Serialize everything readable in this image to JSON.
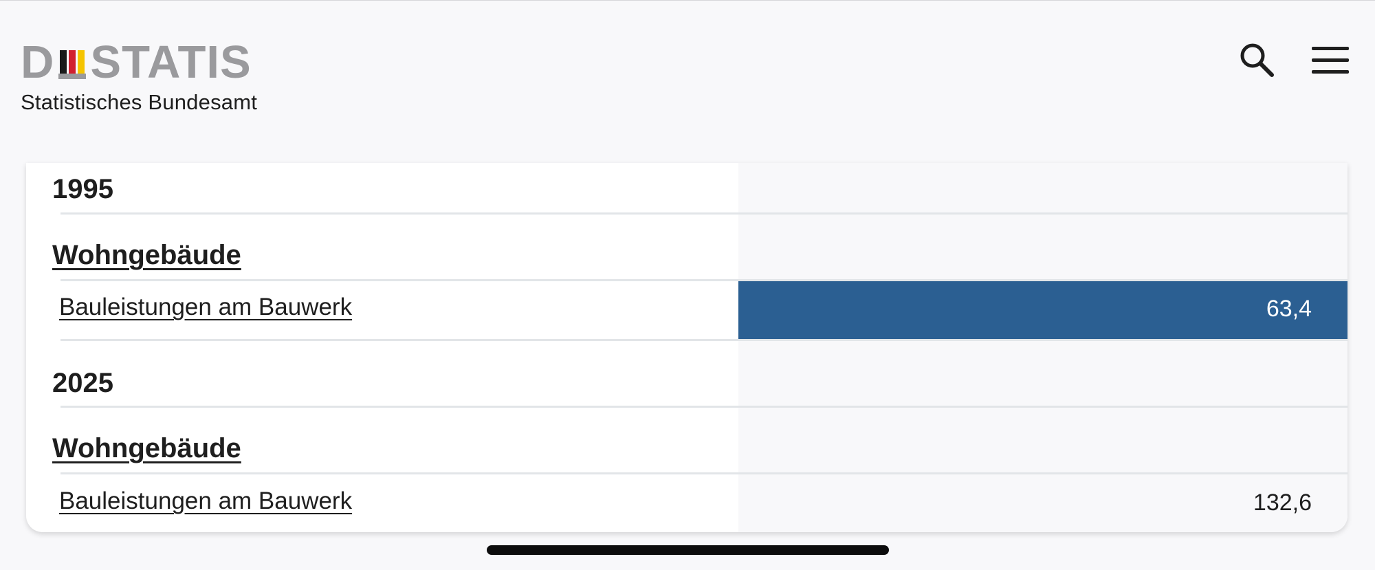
{
  "header": {
    "logo_text_left": "D",
    "logo_text_right": "STATIS",
    "subtitle": "Statistisches Bundesamt"
  },
  "icons": {
    "search": "search-icon",
    "menu": "hamburger-menu-icon"
  },
  "colors": {
    "bar": "#2b5f92",
    "logo_gray": "#9a9a9d",
    "flag_black": "#1a1a1a",
    "flag_red": "#d2202f",
    "flag_gold": "#f5c400"
  },
  "table": {
    "sections": [
      {
        "year": "1995",
        "group": "Wohngebäude",
        "item": "Bauleistungen am Bauwerk",
        "value": "63,4",
        "highlighted": true
      },
      {
        "year": "2025",
        "group": "Wohngebäude",
        "item": "Bauleistungen am Bauwerk",
        "value": "132,6",
        "highlighted": false
      }
    ]
  }
}
